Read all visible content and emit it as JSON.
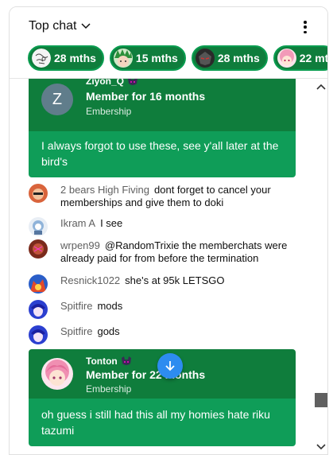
{
  "header": {
    "title": "Top chat",
    "dropdown_icon": "chevron-down-icon",
    "more_icon": "more-vert-icon"
  },
  "tickers": [
    {
      "label": "28 mths",
      "avatar": "doodle-avatar"
    },
    {
      "label": "15 mths",
      "avatar": "anime-green-hair-avatar"
    },
    {
      "label": "28 mths",
      "avatar": "dark-mask-avatar"
    },
    {
      "label": "22 mt",
      "avatar": "pink-hair-avatar"
    }
  ],
  "top_card": {
    "author": "Ziyon_Q",
    "avatar_letter": "Z",
    "member_line": "Member for 16 months",
    "sub_line": "Embership",
    "message": "I always forgot to use these, see y'all later at the bird's"
  },
  "messages": [
    {
      "author": "2 bears High Fiving",
      "text": "dont forget to cancel your memberships and give them to doki"
    },
    {
      "author": "Ikram A",
      "text": "I see"
    },
    {
      "author": "wrpen99",
      "text": "@RandomTrixie the memberchats were already paid for from before the termination"
    },
    {
      "author": "Resnick1022",
      "text": "she's at 95k LETSGO"
    },
    {
      "author": "Spitfire",
      "text": "mods"
    },
    {
      "author": "Spitfire",
      "text": "gods"
    }
  ],
  "bottom_card": {
    "author": "Tonton",
    "member_line": "Member for 22 months",
    "sub_line": "Embership",
    "message": "oh guess i still had this all my homies hate riku tazumi"
  },
  "colors": {
    "member_head": "#0f7d3c",
    "member_body": "#0f9d58",
    "jump_button": "#2d8cf0"
  }
}
